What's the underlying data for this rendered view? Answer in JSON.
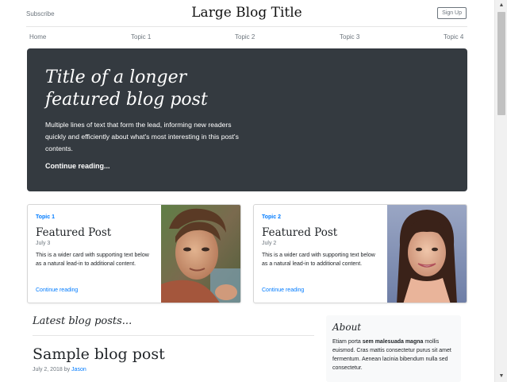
{
  "header": {
    "subscribe": "Subscribe",
    "title": "Large Blog Title",
    "signup": "Sign Up"
  },
  "nav": {
    "items": [
      "Home",
      "Topic 1",
      "Topic 2",
      "Topic 3",
      "Topic 4"
    ]
  },
  "jumbotron": {
    "title": "Title of a longer featured blog post",
    "lead": "Multiple lines of text that form the lead, informing new readers quickly and efficiently about what's most interesting in this post's contents.",
    "cta": "Continue reading..."
  },
  "cards": [
    {
      "topic": "Topic 1",
      "title": "Featured Post",
      "date": "July 3",
      "text": "This is a wider card with supporting text below as a natural lead-in to additional content.",
      "link": "Continue reading",
      "image": "young-man-photo"
    },
    {
      "topic": "Topic 2",
      "title": "Featured Post",
      "date": "July 2",
      "text": "This is a wider card with supporting text below as a natural lead-in to additional content.",
      "link": "Continue reading",
      "image": "young-woman-photo"
    }
  ],
  "main": {
    "section_title": "Latest blog posts...",
    "post_title": "Sample blog post",
    "post_date": "July 2, 2018 by",
    "post_author": "Jason"
  },
  "sidebar": {
    "about_title": "About",
    "about_pre": "Etiam porta ",
    "about_bold": "sem malesuada magna",
    "about_post": " mollis euismod. Cras mattis consectetur purus sit amet fermentum. Aenean lacinia bibendum nulla sed consectetur."
  },
  "colors": {
    "accent": "#007bff",
    "jumbotron_bg": "#343a40",
    "muted": "#6c757d"
  },
  "scrollbar": {
    "up_icon": "triangle-up-icon",
    "down_icon": "triangle-down-icon"
  }
}
